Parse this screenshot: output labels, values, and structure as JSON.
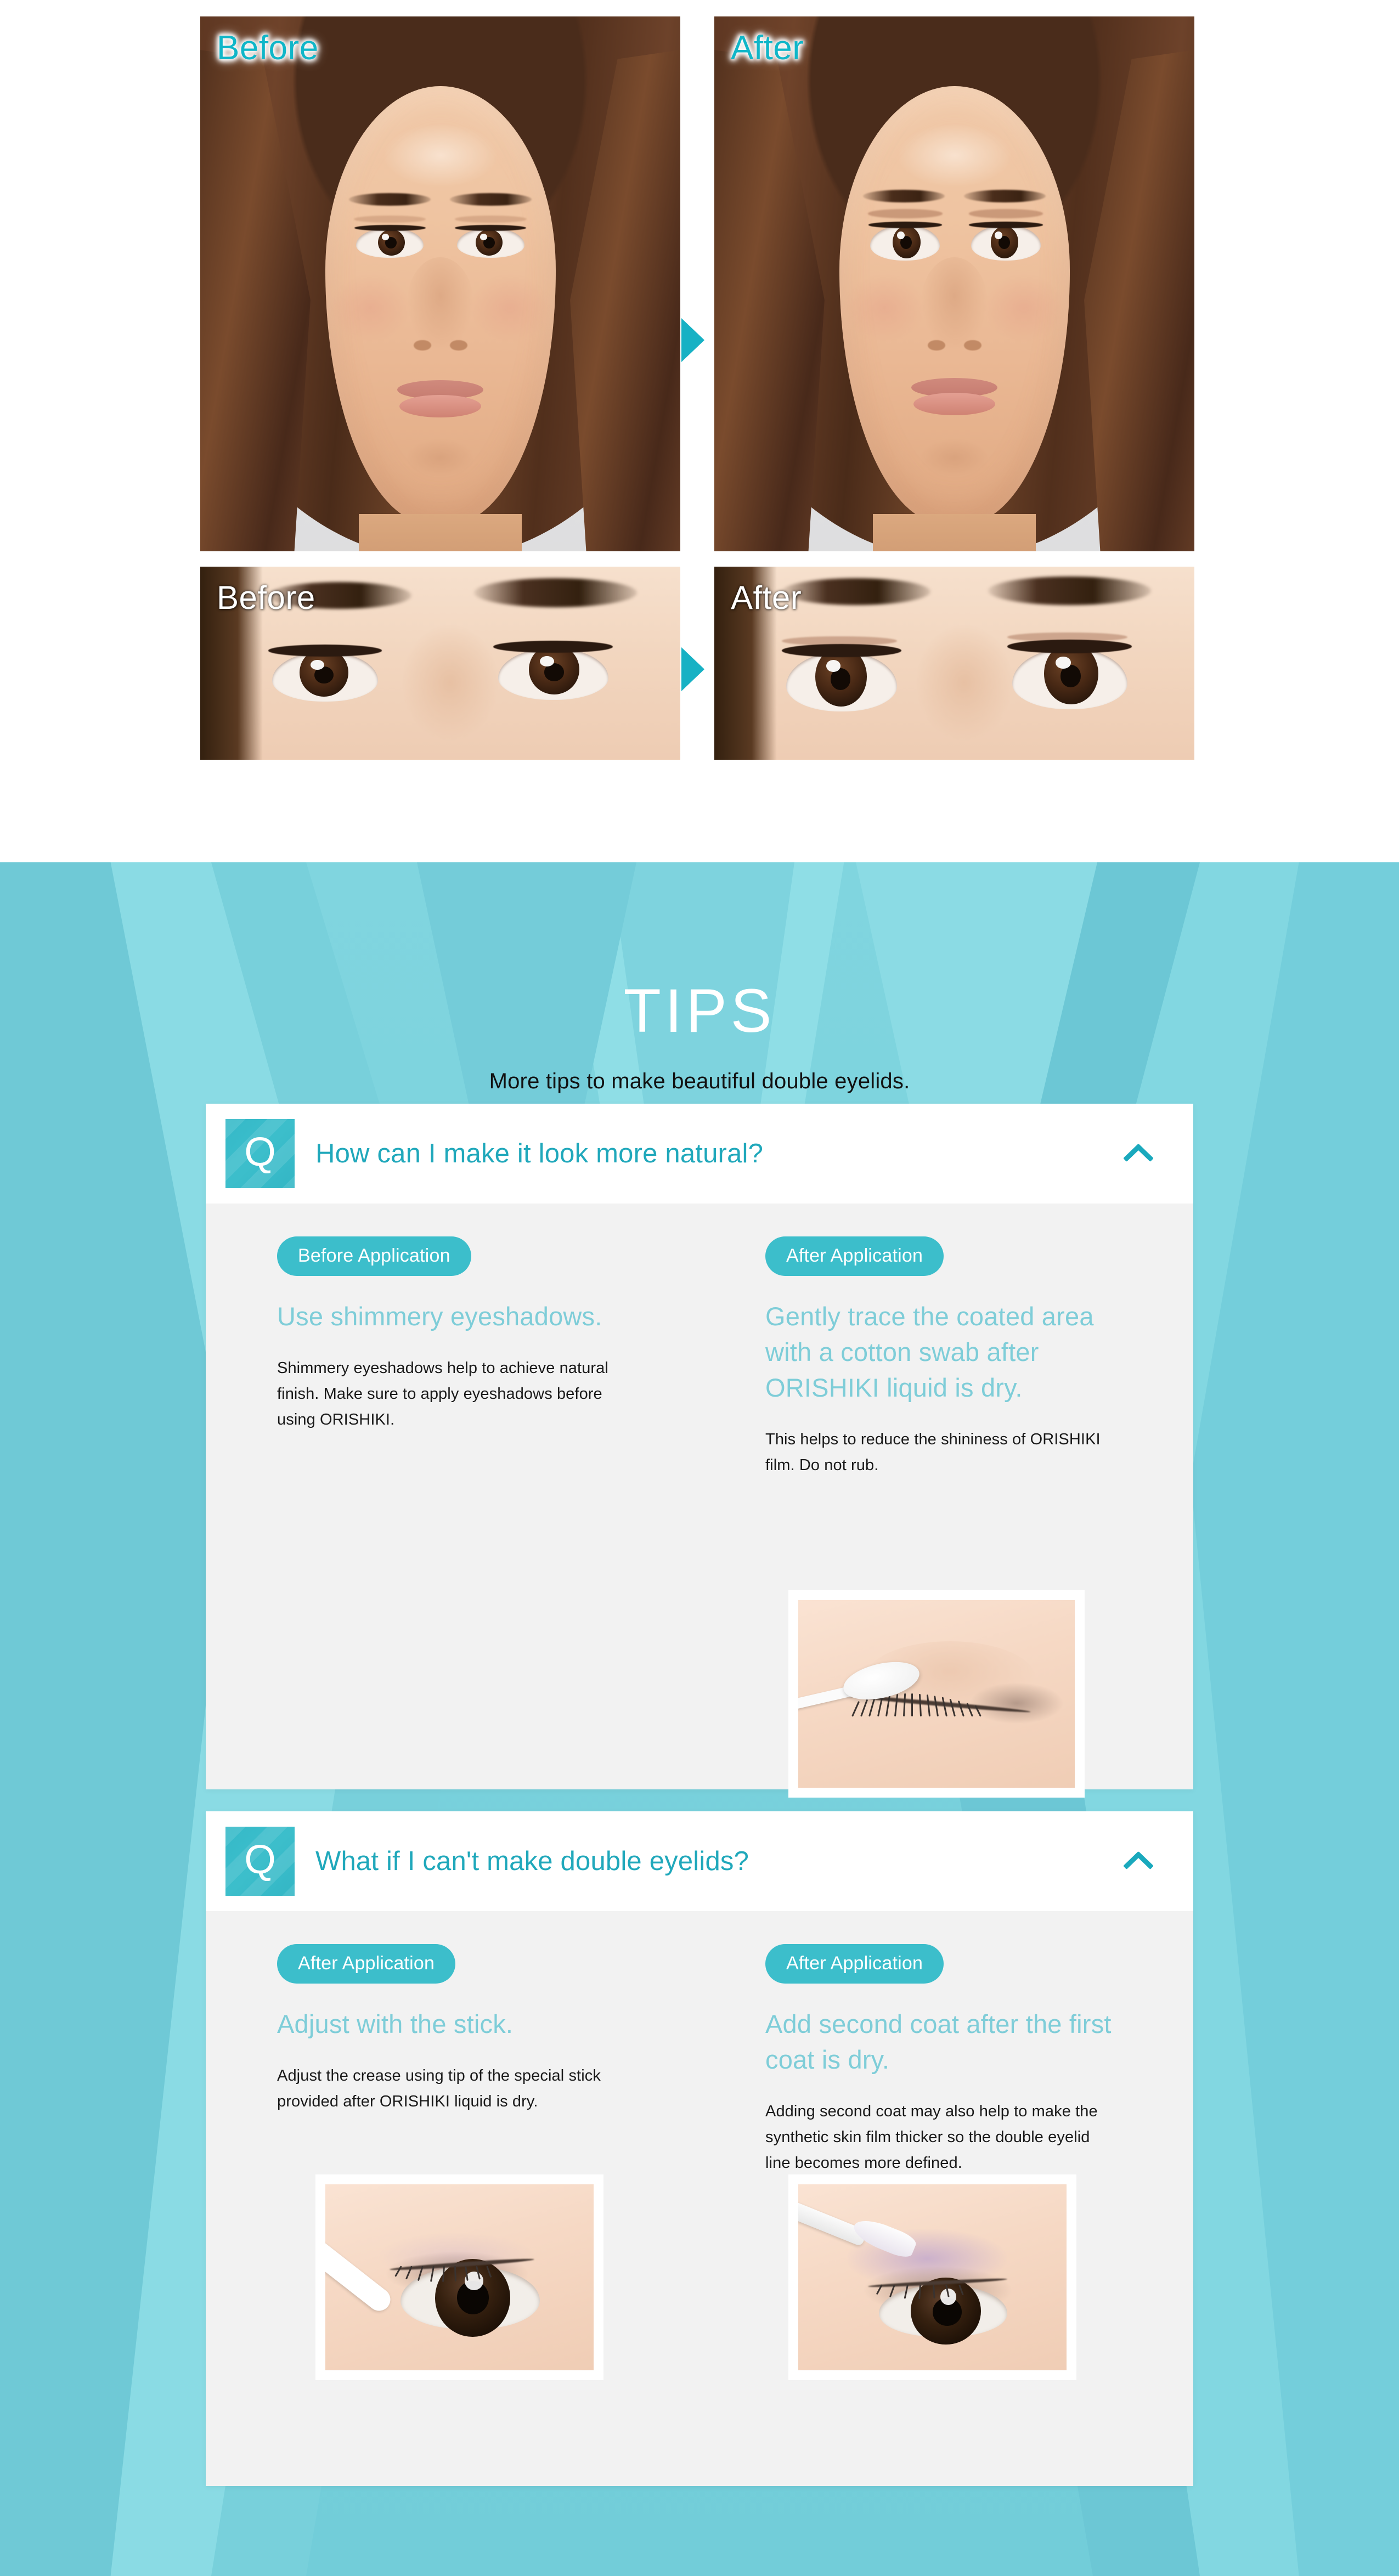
{
  "comparison": {
    "rows": [
      {
        "before_label": "Before",
        "after_label": "After",
        "arrow_icon": "arrow-right-triangle-icon",
        "type": "full-face"
      },
      {
        "before_label": "Before",
        "after_label": "After",
        "arrow_icon": "arrow-right-triangle-icon",
        "type": "eye-closeup"
      }
    ]
  },
  "tips": {
    "title": "TIPS",
    "subtitle": "More tips to make beautiful double eyelids.",
    "badge_letter": "Q",
    "colors": {
      "accent": "#3cbecb",
      "background": "#7fd4de",
      "question_text": "#20a8bb",
      "tip_heading": "#7ecdd8",
      "card_body": "#f2f2f2"
    },
    "cards": [
      {
        "question": "How can I make it look more natural?",
        "toggle_icon": "chevron-up-icon",
        "expanded": true,
        "columns": [
          {
            "pill": "Before Application",
            "heading": "Use shimmery eyeshadows.",
            "body": "Shimmery eyeshadows help to achieve natural finish. Make sure to apply eyeshadows before using ORISHIKI.",
            "image": null
          },
          {
            "pill": "After Application",
            "heading": "Gently trace the coated area with a cotton swab after ORISHIKI liquid is dry.",
            "body": "This helps to reduce the shininess of ORISHIKI film. Do not rub.",
            "image": "cotton-swab-on-eyelid-photo"
          }
        ]
      },
      {
        "question": "What if I can't make double eyelids?",
        "toggle_icon": "chevron-up-icon",
        "expanded": true,
        "columns": [
          {
            "pill": "After Application",
            "heading": "Adjust with the stick.",
            "body": "Adjust the crease using tip of the special stick provided after ORISHIKI liquid is dry.",
            "image": "stick-adjusting-crease-photo"
          },
          {
            "pill": "After Application",
            "heading": "Add second coat after the first coat is dry.",
            "body": "Adding second coat may also help to make the synthetic skin film thicker so the double eyelid line becomes more defined.",
            "image": "applicator-second-coat-photo"
          }
        ]
      }
    ]
  }
}
